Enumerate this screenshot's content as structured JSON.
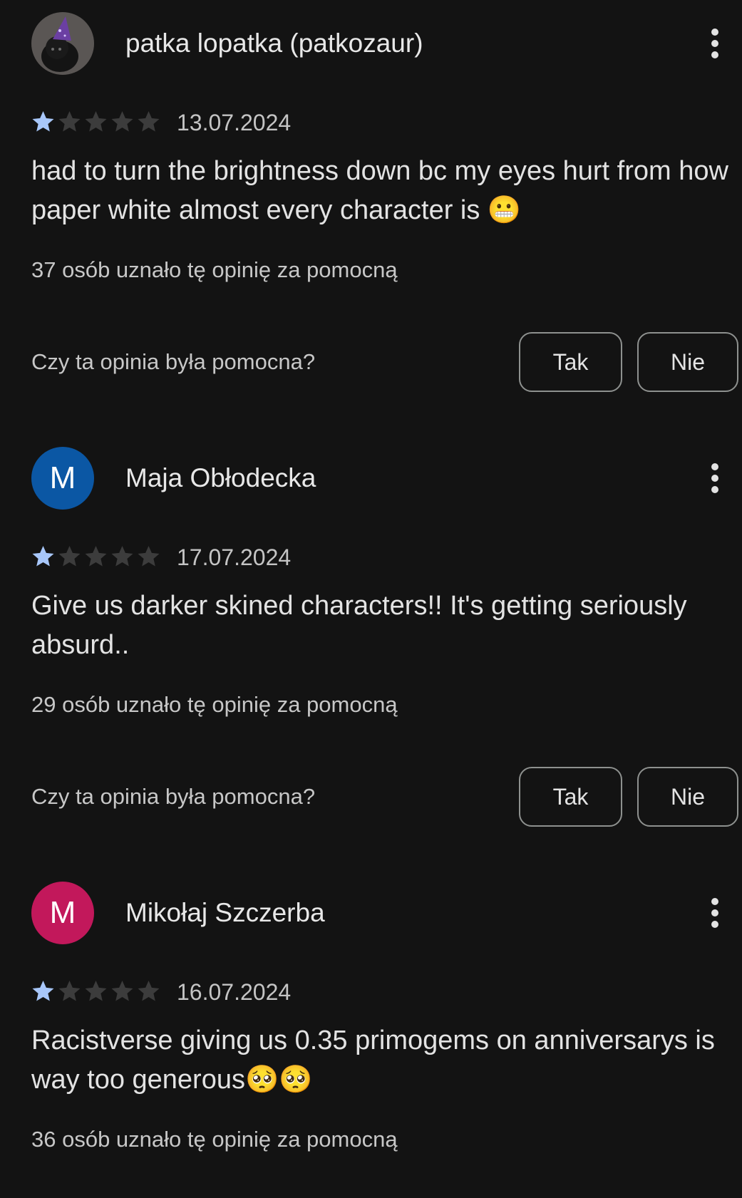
{
  "reviews": [
    {
      "author": "patka lopatka (patkozaur)",
      "avatar_type": "photo",
      "avatar_letter": "",
      "rating": 1,
      "max_rating": 5,
      "date": "13.07.2024",
      "text": "had to turn the brightness down bc my eyes hurt from how paper white almost every character is 😬",
      "helpful_count_text": "37 osób uznało tę opinię za pomocną",
      "helpful_question": "Czy ta opinia była pomocna?",
      "yes_label": "Tak",
      "no_label": "Nie"
    },
    {
      "author": "Maja Obłodecka",
      "avatar_type": "letter",
      "avatar_letter": "M",
      "avatar_color": "#0b57a4",
      "rating": 1,
      "max_rating": 5,
      "date": "17.07.2024",
      "text": "Give us darker skined characters!! It's getting seriously absurd..",
      "helpful_count_text": "29 osób uznało tę opinię za pomocną",
      "helpful_question": "Czy ta opinia była pomocna?",
      "yes_label": "Tak",
      "no_label": "Nie"
    },
    {
      "author": "Mikołaj Szczerba",
      "avatar_type": "letter",
      "avatar_letter": "M",
      "avatar_color": "#c2185b",
      "rating": 1,
      "max_rating": 5,
      "date": "16.07.2024",
      "text": "Racistverse giving us 0.35 primogems on anniversarys is way too generous🥺🥺",
      "helpful_count_text": "36 osób uznało tę opinię za pomocną"
    }
  ],
  "colors": {
    "background": "#131313",
    "star_filled": "#a8c7fa",
    "star_empty": "#3c3c3c"
  },
  "icons": {
    "menu": "more-vert-icon",
    "star": "star-icon"
  }
}
